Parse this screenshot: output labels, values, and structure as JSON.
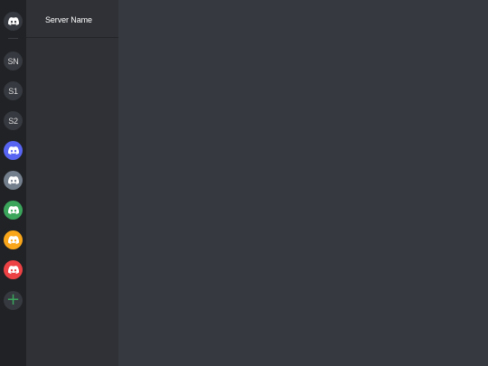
{
  "colors": {
    "rail_bg": "#202225",
    "sidebar_bg": "#2f3136",
    "main_bg": "#36393f",
    "home_bg": "#36393f",
    "text_initials_bg": "#36393f",
    "blurple": "#5865f2",
    "grey": "#747f8d",
    "green": "#3ba55c",
    "yellow": "#faa61a",
    "red": "#ed4245",
    "add_bg": "#36393f",
    "add_plus": "#3ba55c"
  },
  "rail": {
    "home": {
      "icon": "discord-logo-icon"
    },
    "servers": [
      {
        "label": "SN",
        "kind": "initials"
      },
      {
        "label": "S1",
        "kind": "initials"
      },
      {
        "label": "S2",
        "kind": "initials"
      },
      {
        "icon": "discord-logo-icon",
        "color": "#5865f2"
      },
      {
        "icon": "discord-logo-icon",
        "color": "#747f8d"
      },
      {
        "icon": "discord-logo-icon",
        "color": "#3ba55c"
      },
      {
        "icon": "discord-logo-icon",
        "color": "#faa61a"
      },
      {
        "icon": "discord-logo-icon",
        "color": "#ed4245"
      }
    ],
    "add_server": {
      "icon": "plus-icon",
      "symbol": "+"
    }
  },
  "sidebar": {
    "server_name": "Server Name"
  }
}
